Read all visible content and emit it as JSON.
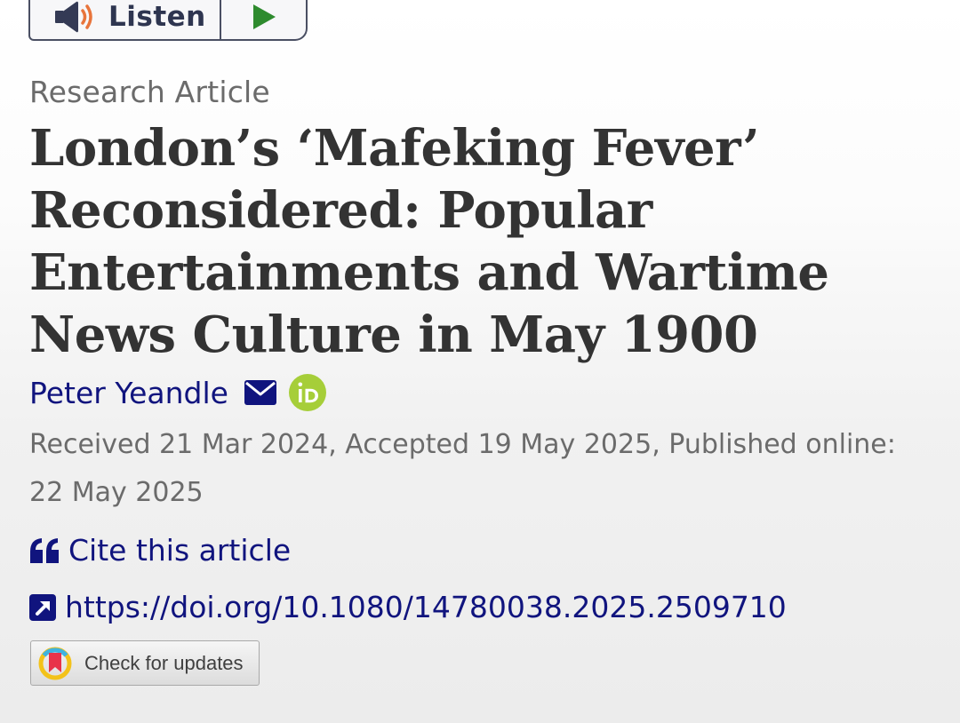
{
  "listen": {
    "label": "Listen",
    "speaker_icon": "speaker-volume-icon",
    "play_icon": "play-icon",
    "play_color": "#2e8b2e"
  },
  "article": {
    "type": "Research Article",
    "title": "London’s ‘Mafeking Fever’ Reconsidered: Popular Entertainments and Wartime News Culture in May 1900",
    "author": {
      "name": "Peter Yeandle",
      "mail_icon": "envelope-icon",
      "orcid_icon": "orcid-icon",
      "orcid_color": "#a6ce39"
    },
    "dates": "Received 21 Mar 2024, Accepted 19 May 2025, Published online: 22 May 2025"
  },
  "actions": {
    "cite_label": "Cite this article",
    "cite_icon": "quote-icon",
    "doi": "https://doi.org/10.1080/14780038.2025.2509710",
    "doi_icon": "external-link-icon",
    "check_updates_label": "Check for updates",
    "check_updates_icon": "crossmark-icon"
  },
  "colors": {
    "link": "#10147e",
    "text": "#333333",
    "muted": "#6b6b6b"
  }
}
